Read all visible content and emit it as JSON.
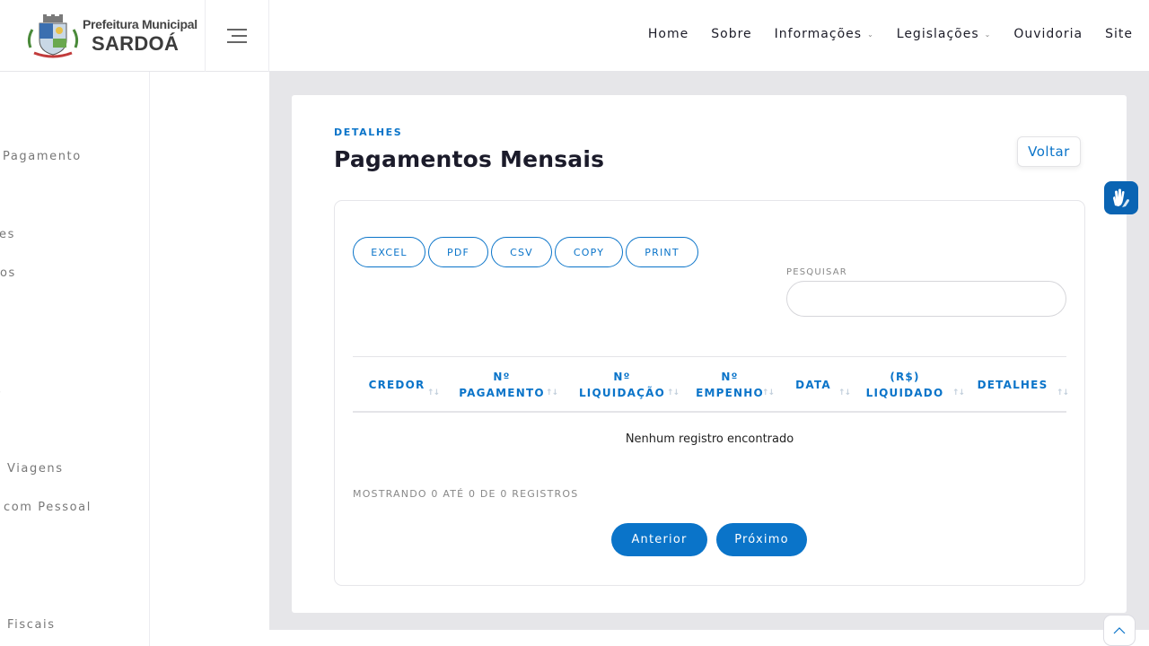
{
  "header": {
    "logo": {
      "line1": "Prefeitura Municipal",
      "line2": "SARDOÁ"
    },
    "nav": [
      {
        "label": "Home"
      },
      {
        "label": "Sobre"
      },
      {
        "label": "Informações",
        "dropdown": true
      },
      {
        "label": "Legislações",
        "dropdown": true
      },
      {
        "label": "Ouvidoria"
      },
      {
        "label": "Site"
      }
    ]
  },
  "sidebar": {
    "items": [
      {
        "label": "Pagamento"
      },
      {
        "label": "es"
      },
      {
        "label": "os"
      },
      {
        "label": "s"
      },
      {
        "label": "s"
      },
      {
        "label": "s"
      },
      {
        "label": "Viagens"
      },
      {
        "label": "com Pessoal"
      },
      {
        "label": "Fiscais"
      }
    ]
  },
  "main": {
    "eyebrow": "DETALHES",
    "title": "Pagamentos Mensais",
    "back_label": "Voltar",
    "export_buttons": [
      "EXCEL",
      "PDF",
      "CSV",
      "COPY",
      "PRINT"
    ],
    "search": {
      "label": "PESQUISAR",
      "value": "",
      "placeholder": ""
    },
    "table": {
      "columns": [
        {
          "line1": "CREDOR",
          "line2": ""
        },
        {
          "line1": "Nº",
          "line2": "PAGAMENTO"
        },
        {
          "line1": "Nº",
          "line2": "LIQUIDAÇÃO"
        },
        {
          "line1": "Nº",
          "line2": "EMPENHO"
        },
        {
          "line1": "DATA",
          "line2": ""
        },
        {
          "line1": "(R$)",
          "line2": "LIQUIDADO"
        },
        {
          "line1": "DETALHES",
          "line2": ""
        }
      ],
      "sort_glyph": "↑↓",
      "empty_message": "Nenhum registro encontrado"
    },
    "info": "MOSTRANDO 0 ATÉ 0 DE 0 REGISTROS",
    "pagination": {
      "prev": "Anterior",
      "next": "Próximo"
    }
  },
  "widgets": {
    "accessibility_icon": "sign-language-hands-icon",
    "scroll_top_icon": "chevron-up-icon"
  },
  "colors": {
    "accent": "#0a74c9",
    "main_bg": "#e6e6e9",
    "vlibras": "#0a64b3"
  }
}
